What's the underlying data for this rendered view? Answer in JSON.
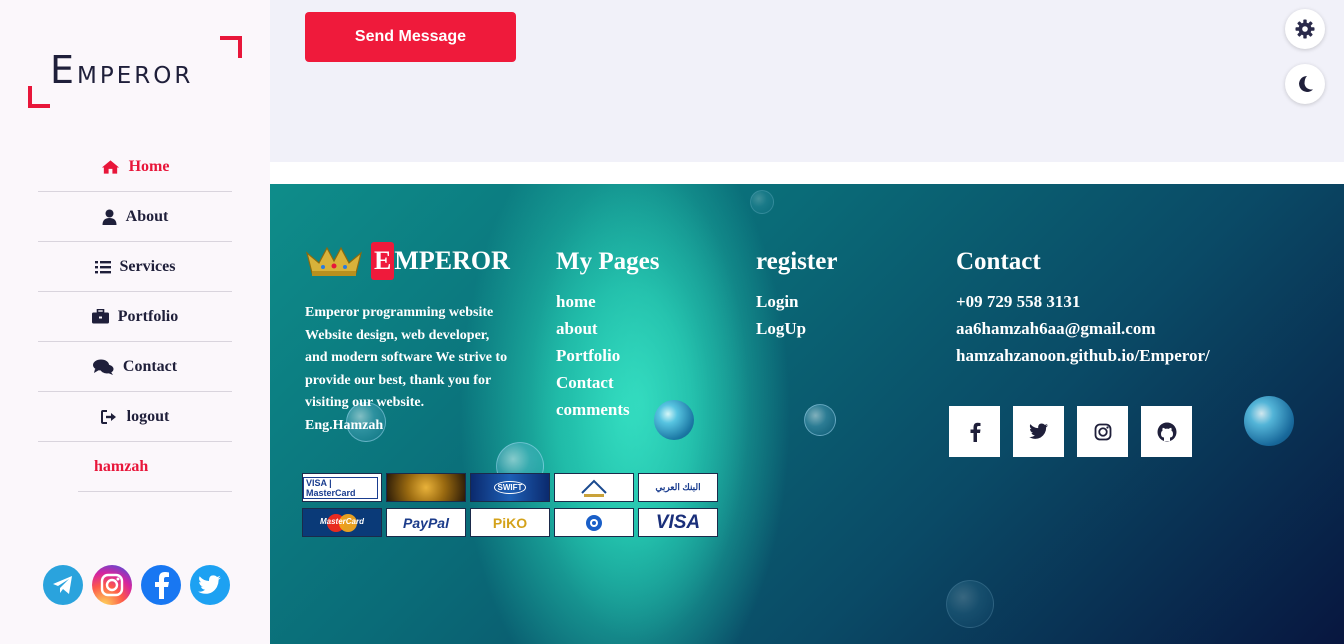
{
  "sidebar": {
    "logo_big": "E",
    "logo_rest": "MPEROR",
    "nav": [
      {
        "label": "Home",
        "icon": "home-icon"
      },
      {
        "label": "About",
        "icon": "user-icon"
      },
      {
        "label": "Services",
        "icon": "list-icon"
      },
      {
        "label": "Portfolio",
        "icon": "briefcase-icon"
      },
      {
        "label": "Contact",
        "icon": "comments-icon"
      },
      {
        "label": "logout",
        "icon": "sign-out-icon"
      }
    ],
    "user": "hamzah",
    "socials": [
      "telegram-icon",
      "instagram-icon",
      "facebook-icon",
      "twitter-icon"
    ]
  },
  "form": {
    "send_label": "Send Message"
  },
  "controls": [
    "gear-icon",
    "moon-icon"
  ],
  "footer": {
    "brand_e": "E",
    "brand_rest": "MPEROR",
    "description": "Emperor programming website Website design, web developer, and modern software We strive to provide our best, thank you for visiting our website.",
    "signature": "Eng.Hamzah",
    "my_pages": {
      "title": "My Pages",
      "links": [
        "home",
        "about",
        "Portfolio",
        "Contact",
        "comments"
      ]
    },
    "register": {
      "title": "register",
      "links": [
        "Login",
        "LogUp"
      ]
    },
    "contact": {
      "title": "Contact",
      "phone": "+09 729 558 3131",
      "email": "aa6hamzah6aa@gmail.com",
      "site": "hamzahzanoon.github.io/Emperor/"
    },
    "contact_socials": [
      "facebook-icon",
      "twitter-icon",
      "instagram-icon",
      "github-icon"
    ],
    "payment_cards": [
      {
        "name": "visa-mastercard-logo",
        "text": "VISA | MasterCard"
      },
      {
        "name": "bitcoin-logo",
        "text": ""
      },
      {
        "name": "swift-logo",
        "text": "SWIFT"
      },
      {
        "name": "bank-logo-1",
        "text": ""
      },
      {
        "name": "arab-bank-logo",
        "text": "البنك العربي"
      },
      {
        "name": "mastercard-logo",
        "text": "MasterCard"
      },
      {
        "name": "paypal-logo",
        "text": "PayPal"
      },
      {
        "name": "piko-logo",
        "text": "PiKO"
      },
      {
        "name": "bank-logo-2",
        "text": ""
      },
      {
        "name": "visa-logo",
        "text": "VISA"
      }
    ]
  }
}
